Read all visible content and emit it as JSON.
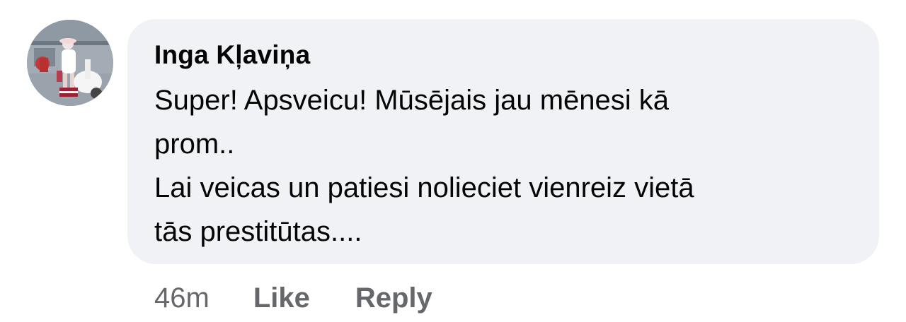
{
  "comment": {
    "author": "Inga Kļaviņa",
    "avatar_icon": "user-avatar-photo",
    "text": "Super! Apsveicu! Mūsējais jau mēnesi kā\nprom..\nLai veicas un patiesi nolieciet vienreiz vietā\ntās prestitūtas....",
    "timestamp": "46m",
    "like_label": "Like",
    "reply_label": "Reply"
  },
  "colors": {
    "bubble_bg": "#f0f2f5",
    "text": "#050505",
    "secondary_text": "#65676b"
  }
}
